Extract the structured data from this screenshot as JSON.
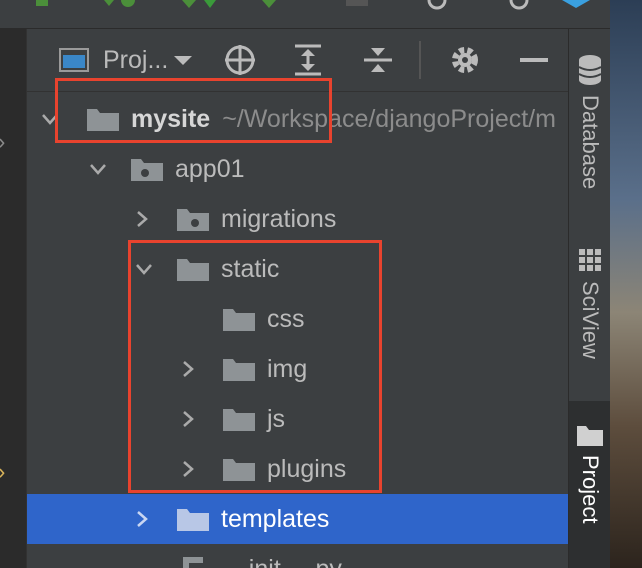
{
  "panel": {
    "view_selector_label": "Proj...",
    "tree": [
      {
        "label": "mysite",
        "path": "~/Workspace/djangoProject/m",
        "expanded": true,
        "bold": true,
        "icon": "folder-icon"
      },
      {
        "label": "app01",
        "expanded": true,
        "icon": "folder-module-icon"
      },
      {
        "label": "migrations",
        "expanded": false,
        "icon": "folder-module-icon"
      },
      {
        "label": "static",
        "expanded": true,
        "icon": "folder-icon"
      },
      {
        "label": "css",
        "icon": "folder-icon"
      },
      {
        "label": "img",
        "expanded": false,
        "icon": "folder-icon"
      },
      {
        "label": "js",
        "expanded": false,
        "icon": "folder-icon"
      },
      {
        "label": "plugins",
        "expanded": false,
        "icon": "folder-icon"
      },
      {
        "label": "templates",
        "expanded": false,
        "selected": true,
        "icon": "folder-icon"
      },
      {
        "label": "__init__.py",
        "icon": "python-file-icon"
      }
    ]
  },
  "right_tabs": [
    {
      "label": "Database",
      "icon": "database-icon"
    },
    {
      "label": "SciView",
      "icon": "grid-icon"
    },
    {
      "label": "Project",
      "icon": "folder-icon",
      "active": true
    }
  ],
  "colors": {
    "selection": "#2f65ca",
    "highlight_box": "#e8432e",
    "panel_bg": "#3c3f41"
  }
}
